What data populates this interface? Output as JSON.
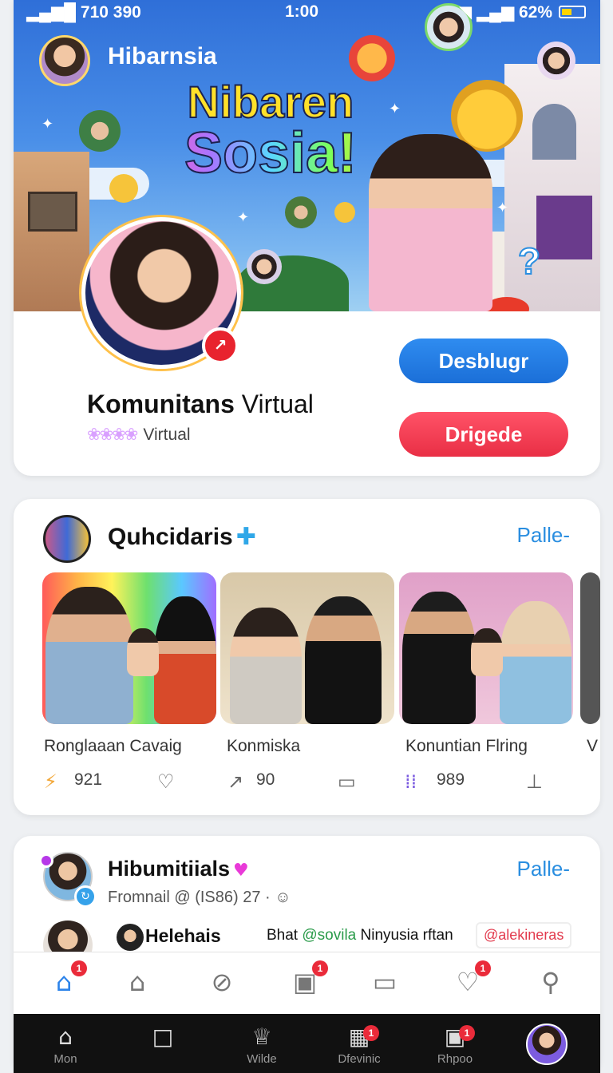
{
  "status_bar": {
    "signal": "▂▄▆█ 710 390",
    "time": "1:00",
    "right": "◥ ▂▄▆ 62%"
  },
  "profile": {
    "community_name": "Hibarnsia",
    "banner_title_line1": "Nibaren",
    "banner_title_line2": "Sosia!",
    "title_bold": "Komunitans",
    "title_rest": " Virtual",
    "subtitle": "Virtual",
    "subtitle_dots": "❀❀❀❀",
    "primary_button": "Desblugr",
    "danger_button": "Drigede",
    "badge_icon": "↗"
  },
  "group": {
    "name": "Quhcidaris",
    "plus_icon": "✚",
    "link": "Palle-",
    "photos": [
      {
        "caption": "Ronglaaan Cavaig",
        "count": "921"
      },
      {
        "caption": "Konmiska",
        "count": "90"
      },
      {
        "caption": "Konuntian Flring",
        "count": "989"
      }
    ],
    "overflow_caption": "V"
  },
  "post": {
    "name": "Hibumitiials",
    "heart": "♥",
    "link": "Palle-",
    "meta": "Fromnail  @ (IS86) 27 · ☺",
    "handle": "Helehais",
    "text_prefix": "Bhat ",
    "mention": "@sovila",
    "text_suffix": " Ninyusia rftan",
    "tag": "@alekineras"
  },
  "app_nav": {
    "items": [
      {
        "icon": "⌂",
        "badge": "1"
      },
      {
        "icon": "⌂",
        "badge": ""
      },
      {
        "icon": "⊘",
        "badge": ""
      },
      {
        "icon": "▣",
        "badge": "1"
      },
      {
        "icon": "▭",
        "badge": ""
      },
      {
        "icon": "♡",
        "badge": "1"
      },
      {
        "icon": "⚲",
        "badge": ""
      }
    ]
  },
  "dock": {
    "items": [
      {
        "icon": "⌂",
        "label": "Mon",
        "badge": ""
      },
      {
        "icon": "□",
        "label": "",
        "badge": ""
      },
      {
        "icon": "♕",
        "label": "Wilde",
        "badge": ""
      },
      {
        "icon": "▦",
        "label": "Dfevinic",
        "badge": "1"
      },
      {
        "icon": "▣",
        "label": "Rhpoo",
        "badge": "1"
      }
    ]
  },
  "colors": {
    "accent_blue": "#2c83ea",
    "danger_red": "#e92f45",
    "link_blue": "#2a8ee0"
  }
}
